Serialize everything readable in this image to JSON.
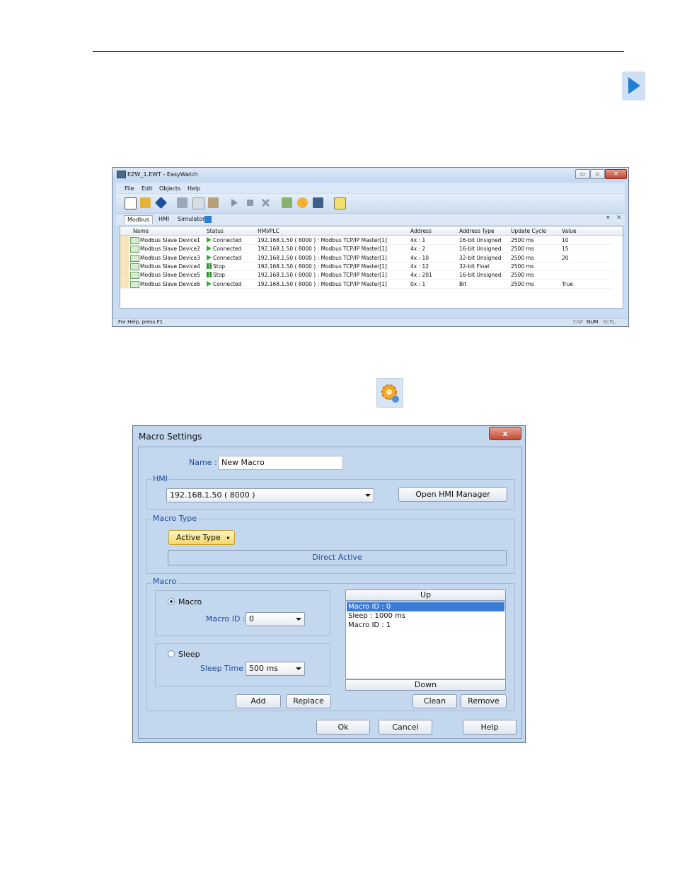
{
  "ew": {
    "title": "EZW_1.EWT - EasyWatch",
    "menu": [
      "File",
      "Edit",
      "Objects",
      "Help"
    ],
    "tabs": [
      "Modbus",
      "HMI",
      "Simulator"
    ],
    "columns": [
      "Name",
      "Status",
      "HMI/PLC",
      "Address",
      "Address Type",
      "Update Cycle",
      "Value"
    ],
    "rows": [
      {
        "name": "Modbus Slave Device1",
        "status": "Connected",
        "hmi": "192.168.1.50 ( 8000 ) : Modbus TCP/IP Master[1]",
        "address": "4x : 1",
        "type": "16-bit Unsigned",
        "cycle": "2500 ms",
        "value": "10"
      },
      {
        "name": "Modbus Slave Device2",
        "status": "Connected",
        "hmi": "192.168.1.50 ( 8000 ) : Modbus TCP/IP Master[1]",
        "address": "4x : 2",
        "type": "16-bit Unsigned",
        "cycle": "2500 ms",
        "value": "15"
      },
      {
        "name": "Modbus Slave Device3",
        "status": "Connected",
        "hmi": "192.168.1.50 ( 8000 ) : Modbus TCP/IP Master[1]",
        "address": "4x : 10",
        "type": "32-bit Unsigned",
        "cycle": "2500 ms",
        "value": "20"
      },
      {
        "name": "Modbus Slave Device4",
        "status": "Stop",
        "hmi": "192.168.1.50 ( 8000 ) : Modbus TCP/IP Master[1]",
        "address": "4x : 12",
        "type": "32-bit Float",
        "cycle": "2500 ms",
        "value": ""
      },
      {
        "name": "Modbus Slave Device5",
        "status": "Stop",
        "hmi": "192.168.1.50 ( 8000 ) : Modbus TCP/IP Master[1]",
        "address": "4x : 201",
        "type": "16-bit Unsigned",
        "cycle": "2500 ms",
        "value": ""
      },
      {
        "name": "Modbus Slave Device6",
        "status": "Connected",
        "hmi": "192.168.1.50 ( 8000 ) : Modbus TCP/IP Master[1]",
        "address": "0x : 1",
        "type": "Bit",
        "cycle": "2500 ms",
        "value": "True"
      }
    ],
    "status_help": "For Help, press F1",
    "status_flags": [
      "CAP",
      "NUM",
      "SCRL"
    ]
  },
  "macro": {
    "title": "Macro Settings",
    "close": "x",
    "name_label": "Name :",
    "name_value": "New Macro",
    "hmi_group": "HMI",
    "hmi_value": "192.168.1.50 ( 8000 )",
    "open_hmi_manager": "Open HMI Manager",
    "type_group": "Macro Type",
    "active_type": "Active Type",
    "direct_active": "Direct Active",
    "macro_group": "Macro",
    "macro_radio": "Macro",
    "macro_id_label": "Macro ID :",
    "macro_id_value": "0",
    "sleep_radio": "Sleep",
    "sleep_time_label": "Sleep Time :",
    "sleep_time_value": "500 ms",
    "up": "Up",
    "down": "Down",
    "list_items": [
      "Macro ID : 0",
      "Sleep : 1000 ms",
      "Macro ID : 1"
    ],
    "add": "Add",
    "replace": "Replace",
    "clean": "Clean",
    "remove": "Remove",
    "ok": "Ok",
    "cancel": "Cancel",
    "help": "Help"
  },
  "icons": [
    "play-icon",
    "macro-settings-gear-icon"
  ],
  "colors": {
    "window_blue": "#c9dcf1",
    "selection": "#3a7bd5",
    "play_green": "#38a838"
  }
}
